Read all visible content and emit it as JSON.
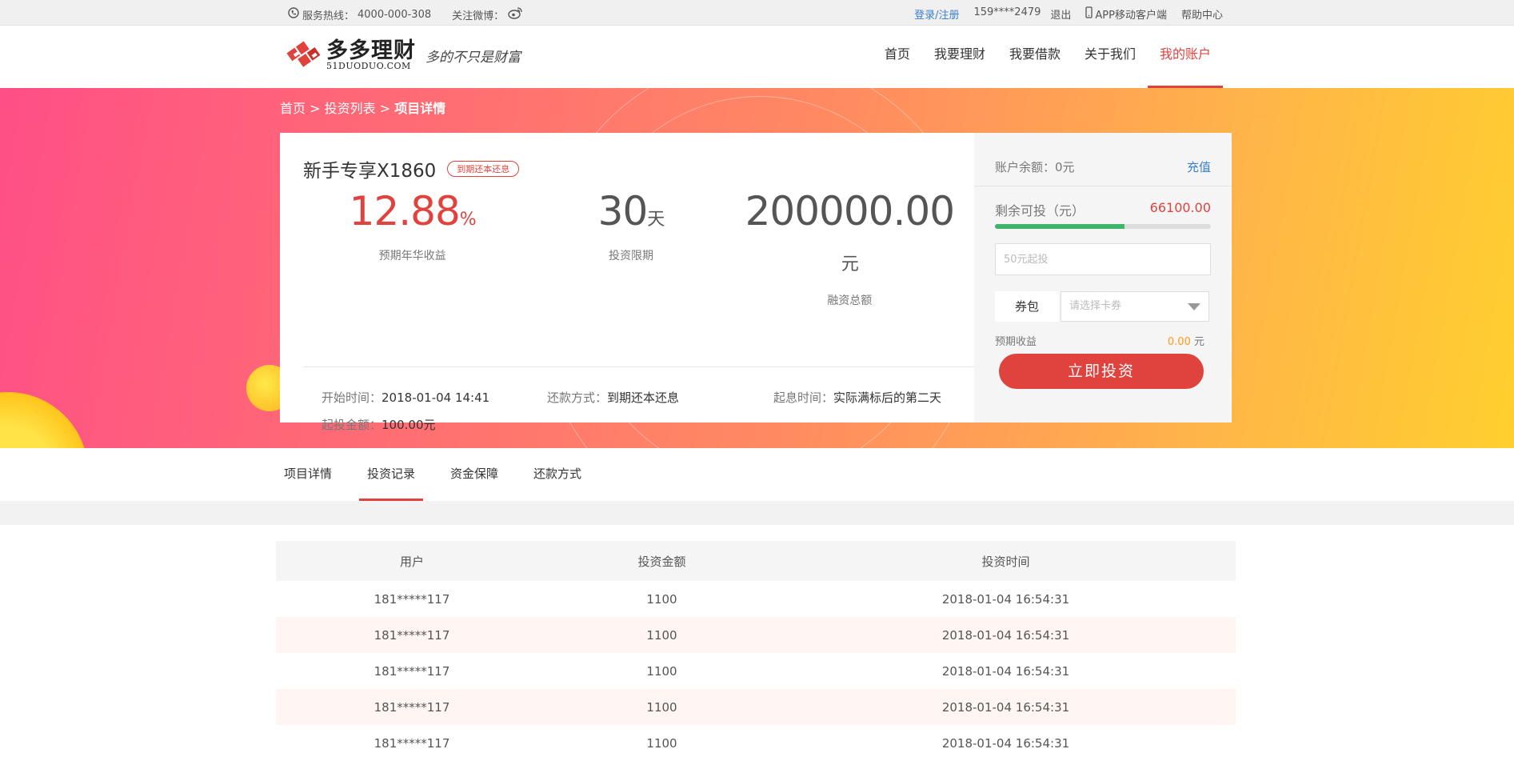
{
  "topbar": {
    "hotline_label": "服务热线：",
    "hotline_number": "4000-000-308",
    "weibo_label": "关注微博：",
    "login": "登录/注册",
    "user": "159****2479",
    "logout": "退出",
    "app": "APP移动客户端",
    "help": "帮助中心"
  },
  "header": {
    "logo_cn": "多多理财",
    "logo_en": "51DUODUO.COM",
    "slogan": "多的不只是财富",
    "nav": [
      {
        "label": "首页"
      },
      {
        "label": "我要理财"
      },
      {
        "label": "我要借款"
      },
      {
        "label": "关于我们"
      },
      {
        "label": "我的账户"
      }
    ]
  },
  "breadcrumb": {
    "home": "首页",
    "list": "投资列表",
    "current": "项目详情",
    "sep": ">"
  },
  "product": {
    "name": "新手专享X1860",
    "tag": "到期还本还息",
    "rate_value": "12.88",
    "rate_unit": "%",
    "rate_label": "预期年华收益",
    "term_value": "30",
    "term_unit": "天",
    "term_label": "投资限期",
    "amount_value": "200000.00",
    "amount_unit": "元",
    "amount_label": "融资总额",
    "start_key": "开始时间：",
    "start_val": "2018-01-04 14:41",
    "repay_key": "还款方式：",
    "repay_val": "到期还本还息",
    "interest_key": "起息时间：",
    "interest_val": "实际满标后的第二天",
    "min_key": "起投金额：",
    "min_val": "100.00元"
  },
  "side": {
    "balance_label": "账户余额：",
    "balance_value": "0元",
    "recharge": "充值",
    "remain_label": "剩余可投（元）",
    "remain_value": "66100.00",
    "progress": 0.6,
    "input_placeholder": "50元起投",
    "coupon_label": "券包",
    "coupon_placeholder": "请选择卡券",
    "expect_label": "预期收益",
    "expect_value": "0.00",
    "expect_unit": "元",
    "invest_button": "立即投资"
  },
  "tabs": [
    {
      "label": "项目详情"
    },
    {
      "label": "投资记录"
    },
    {
      "label": "资金保障"
    },
    {
      "label": "还款方式"
    }
  ],
  "records": {
    "headers": [
      "用户",
      "投资金额",
      "投资时间"
    ],
    "rows": [
      [
        "181*****117",
        "1100",
        "2018-01-04 16:54:31"
      ],
      [
        "181*****117",
        "1100",
        "2018-01-04 16:54:31"
      ],
      [
        "181*****117",
        "1100",
        "2018-01-04 16:54:31"
      ],
      [
        "181*****117",
        "1100",
        "2018-01-04 16:54:31"
      ],
      [
        "181*****117",
        "1100",
        "2018-01-04 16:54:31"
      ]
    ]
  },
  "colors": {
    "accent": "#e0433e",
    "progress": "#3fb56a",
    "link": "#3b7fd0",
    "orange": "#ff9a1a"
  }
}
